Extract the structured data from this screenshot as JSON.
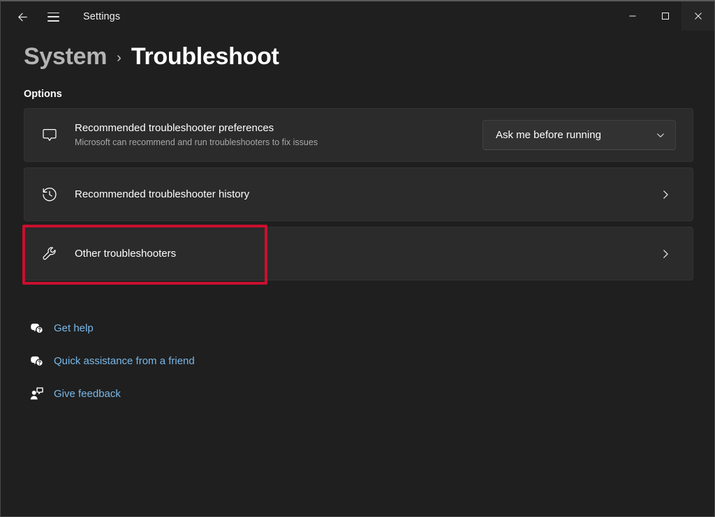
{
  "window": {
    "app_title": "Settings",
    "back_icon": "back-arrow-icon",
    "menu_icon": "hamburger-menu-icon",
    "controls": {
      "minimize": "minimize-icon",
      "maximize": "maximize-icon",
      "close": "close-icon"
    }
  },
  "breadcrumb": {
    "parent": "System",
    "separator": "›",
    "current": "Troubleshoot"
  },
  "main": {
    "section_label": "Options",
    "cards": [
      {
        "icon": "speech-bubble-icon",
        "title": "Recommended troubleshooter preferences",
        "subtitle": "Microsoft can recommend and run troubleshooters to fix issues",
        "control": "dropdown",
        "dropdown_value": "Ask me before running"
      },
      {
        "icon": "history-clock-icon",
        "title": "Recommended troubleshooter history",
        "subtitle": "",
        "control": "chevron",
        "chevron": "›"
      },
      {
        "icon": "wrench-icon",
        "title": "Other troubleshooters",
        "subtitle": "",
        "control": "chevron",
        "chevron": "›",
        "highlighted": true
      }
    ]
  },
  "links": [
    {
      "icon": "help-bubble-icon",
      "label": "Get help"
    },
    {
      "icon": "help-bubble-icon",
      "label": "Quick assistance from a friend"
    },
    {
      "icon": "feedback-person-icon",
      "label": "Give feedback"
    }
  ],
  "colors": {
    "page_background": "#1f1f1f",
    "card_background": "#2b2b2b",
    "highlight_red": "#c8102e",
    "link_blue": "#79b8e8",
    "text_primary": "#ffffff",
    "text_secondary": "#a8a8a8"
  }
}
